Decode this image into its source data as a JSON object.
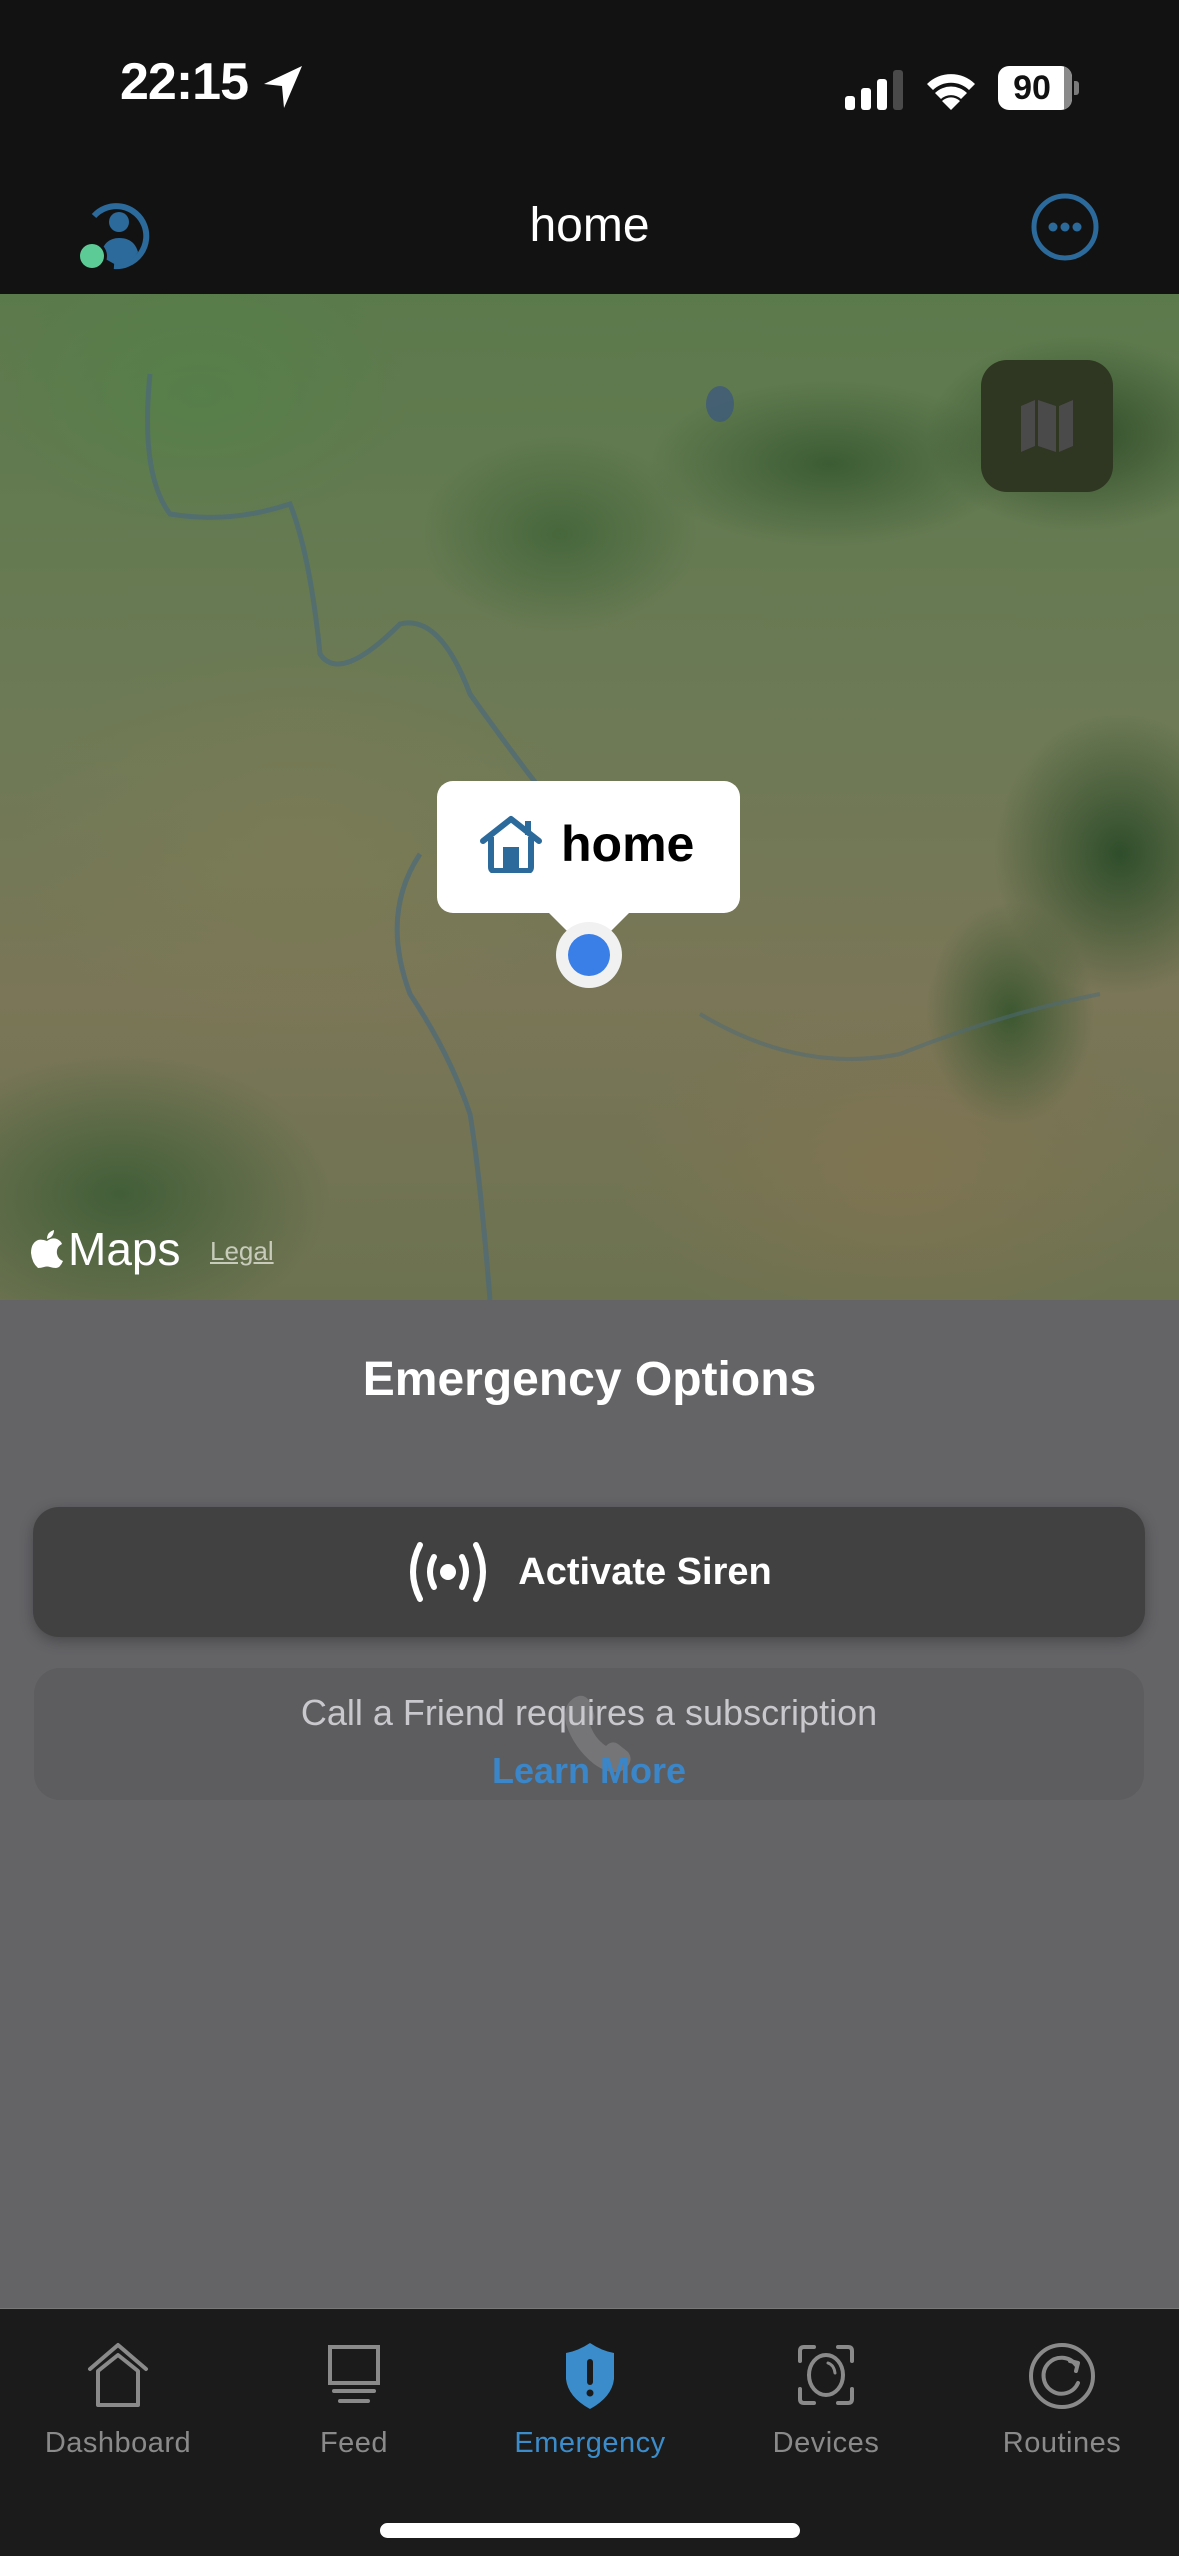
{
  "status_bar": {
    "time": "22:15",
    "battery_level": "90",
    "icons": [
      "location-arrow-icon",
      "cellular-signal-icon",
      "wifi-icon",
      "battery-icon"
    ],
    "signal_bars_filled": 3,
    "signal_bars_total": 4
  },
  "header": {
    "title": "home",
    "left_icon": "profile-status-icon",
    "right_icon": "more-options-icon"
  },
  "map": {
    "callout_label": "home",
    "callout_icon": "house-icon",
    "map_type_icon": "map-icon",
    "brand": "Maps",
    "legal_label": "Legal"
  },
  "emergency": {
    "title": "Emergency Options",
    "siren_button_label": "Activate Siren",
    "siren_icon": "siren-broadcast-icon",
    "call_friend_message": "Call a Friend requires a subscription",
    "call_friend_link": "Learn More",
    "call_friend_icon": "phone-icon"
  },
  "tabs": [
    {
      "label": "Dashboard",
      "icon": "house-outline-icon",
      "active": false
    },
    {
      "label": "Feed",
      "icon": "monitor-icon",
      "active": false
    },
    {
      "label": "Emergency",
      "icon": "shield-alert-icon",
      "active": true
    },
    {
      "label": "Devices",
      "icon": "camera-icon",
      "active": false
    },
    {
      "label": "Routines",
      "icon": "refresh-circle-icon",
      "active": false
    }
  ],
  "colors": {
    "accent": "#3B8CCB",
    "profile_online": "#5CCB95",
    "profile_blue": "#2B6A9B",
    "pin_blue": "#3A7EE8",
    "panel_bg": "#646467",
    "siren_button_bg": "#414141"
  }
}
